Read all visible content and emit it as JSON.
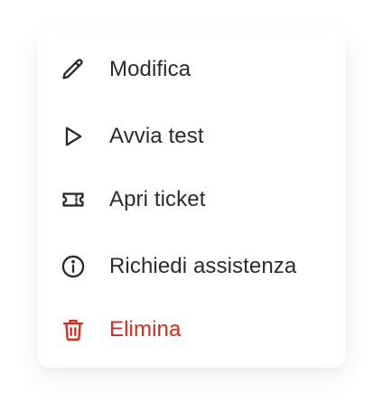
{
  "menu": {
    "items": [
      {
        "label": "Modifica",
        "icon": "pencil-icon"
      },
      {
        "label": "Avvia test",
        "icon": "play-icon"
      },
      {
        "label": "Apri ticket",
        "icon": "ticket-icon"
      },
      {
        "label": "Richiedi assistenza",
        "icon": "info-icon"
      },
      {
        "label": "Elimina",
        "icon": "trash-icon",
        "color": "#d32b1e"
      }
    ]
  },
  "colors": {
    "text": "#2b2b2b",
    "danger": "#d32b1e"
  }
}
